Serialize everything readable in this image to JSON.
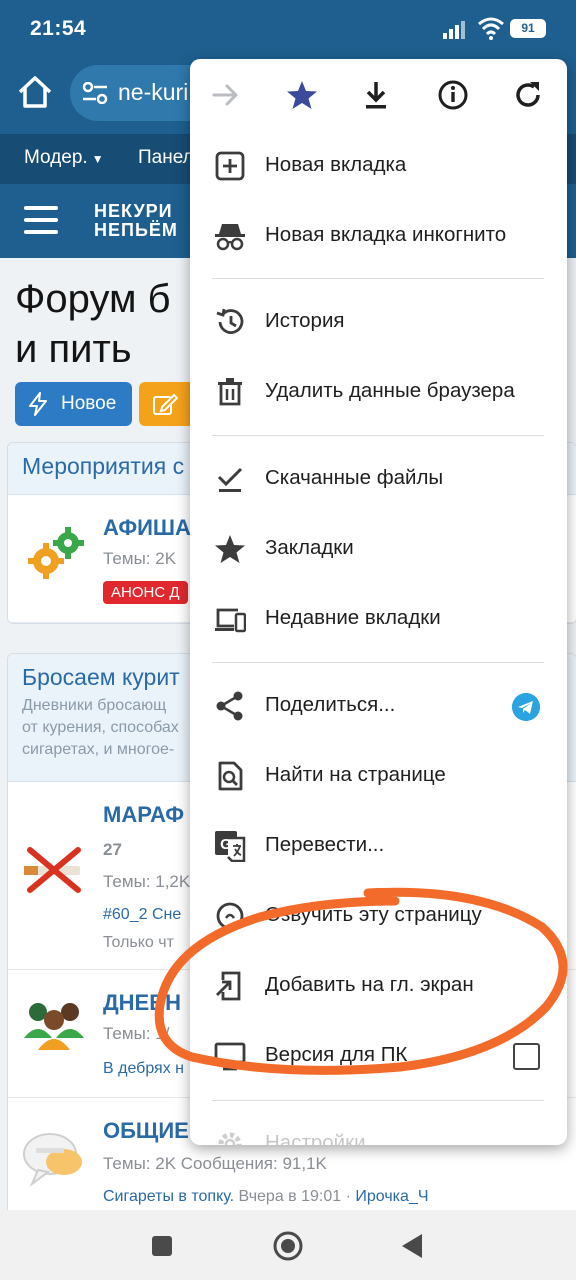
{
  "status_bar": {
    "time": "21:54",
    "battery": "91"
  },
  "toolbar": {
    "url": "ne-kuri"
  },
  "site_nav": {
    "item1": "Модер.",
    "item2": "Панел"
  },
  "site_header": {
    "logo_line1": "НЕКУРИ",
    "logo_line2": "НЕПЬЁМ"
  },
  "page": {
    "title_line1": "Форум б",
    "title_line2": "и пить",
    "new_button": "Новое"
  },
  "section1": {
    "title": "Мероприятия с",
    "node": {
      "title": "АФИША",
      "meta": "Темы: 2K",
      "badge": "АНОНС Д"
    }
  },
  "section2": {
    "title": "Бросаем курит",
    "desc_line1": "Дневники бросающ",
    "desc_line2": "от курения, способах",
    "desc_line3": "сигаретах, и многое-",
    "nodes": [
      {
        "title": "МАРАФ",
        "sub": "27",
        "meta": "Темы: 1,2K",
        "link": "#60_2 Сне",
        "gray": "Только чт"
      },
      {
        "title": "ДНЕВН",
        "meta": "Темы: 1/",
        "link": "В дебрях н"
      },
      {
        "title": "ОБЩИЕ",
        "meta": "Темы: 2K Сообщения: 91,1K",
        "link_text": "Сигареты в топку.",
        "link_time": "Вчера в 19:01",
        "link_sep": "·",
        "link_user": "Ирочка_Ч"
      }
    ]
  },
  "menu": {
    "items": [
      {
        "label": "Новая вкладка",
        "icon": "new-tab-icon"
      },
      {
        "label": "Новая вкладка инкогнито",
        "icon": "incognito-icon"
      },
      {
        "label": "История",
        "icon": "history-icon"
      },
      {
        "label": "Удалить данные браузера",
        "icon": "trash-icon"
      },
      {
        "label": "Скачанные файлы",
        "icon": "downloads-icon"
      },
      {
        "label": "Закладки",
        "icon": "bookmarks-icon"
      },
      {
        "label": "Недавние вкладки",
        "icon": "recent-tabs-icon"
      },
      {
        "label": "Поделиться...",
        "icon": "share-icon"
      },
      {
        "label": "Найти на странице",
        "icon": "find-icon"
      },
      {
        "label": "Перевести...",
        "icon": "translate-icon"
      },
      {
        "label": "Озвучить эту страницу",
        "icon": "speak-icon"
      },
      {
        "label": "Добавить на гл. экран",
        "icon": "add-to-home-icon"
      },
      {
        "label": "Версия для ПК",
        "icon": "desktop-icon"
      },
      {
        "label": "Настройки",
        "icon": "settings-icon"
      }
    ]
  },
  "colors": {
    "toolbar": "#1e5f8f",
    "accent_link": "#2a6aa6",
    "annotation": "#f26b2a",
    "menu_bg": "#ffffff"
  }
}
